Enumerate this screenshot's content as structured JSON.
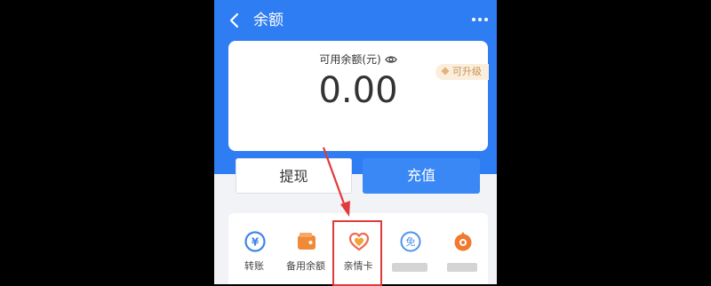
{
  "header": {
    "title": "余额"
  },
  "balance": {
    "label": "可用余额(元)",
    "value": "0.00",
    "upgrade_badge": "可升级"
  },
  "actions": {
    "withdraw_label": "提现",
    "recharge_label": "充值"
  },
  "shortcuts": [
    {
      "label": "转账",
      "icon": "transfer-icon"
    },
    {
      "label": "备用余额",
      "icon": "wallet-icon"
    },
    {
      "label": "亲情卡",
      "icon": "family-card-icon"
    },
    {
      "label": "",
      "icon": "free-icon"
    },
    {
      "label": "",
      "icon": "orange-circle-icon"
    }
  ],
  "colors": {
    "brand_blue": "#2f7df3",
    "recharge_blue": "#3a88f5",
    "highlight_red": "#e23a3a",
    "badge_gold": "#c99356"
  }
}
